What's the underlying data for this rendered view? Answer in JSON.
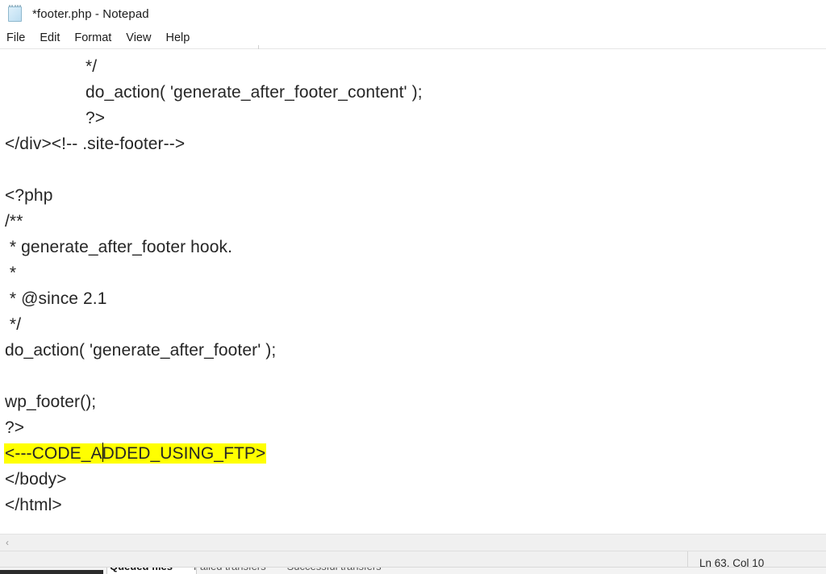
{
  "window": {
    "title": "*footer.php - Notepad",
    "icon": "notepad-icon"
  },
  "menu": {
    "items": [
      {
        "label": "File"
      },
      {
        "label": "Edit"
      },
      {
        "label": "Format"
      },
      {
        "label": "View"
      },
      {
        "label": "Help"
      }
    ]
  },
  "editor": {
    "lines": [
      {
        "text": "*/",
        "indent": true,
        "blank": false,
        "highlight": false
      },
      {
        "text": "do_action( 'generate_after_footer_content' );",
        "indent": true,
        "blank": false,
        "highlight": false
      },
      {
        "text": "?>",
        "indent": true,
        "blank": false,
        "highlight": false
      },
      {
        "text": "</div><!-- .site-footer-->",
        "indent": false,
        "blank": false,
        "highlight": false
      },
      {
        "text": "",
        "indent": false,
        "blank": true,
        "highlight": false
      },
      {
        "text": "<?php",
        "indent": false,
        "blank": false,
        "highlight": false
      },
      {
        "text": "/**",
        "indent": false,
        "blank": false,
        "highlight": false
      },
      {
        "text": " * generate_after_footer hook.",
        "indent": false,
        "blank": false,
        "highlight": false
      },
      {
        "text": " *",
        "indent": false,
        "blank": false,
        "highlight": false
      },
      {
        "text": " * @since 2.1",
        "indent": false,
        "blank": false,
        "highlight": false
      },
      {
        "text": " */",
        "indent": false,
        "blank": false,
        "highlight": false
      },
      {
        "text": "do_action( 'generate_after_footer' );",
        "indent": false,
        "blank": false,
        "highlight": false
      },
      {
        "text": "",
        "indent": false,
        "blank": true,
        "highlight": false
      },
      {
        "text": "wp_footer();",
        "indent": false,
        "blank": false,
        "highlight": false
      },
      {
        "text": "?>",
        "indent": false,
        "blank": false,
        "highlight": false
      },
      {
        "text": "<---CODE_ADDED_USING_FTP>",
        "indent": false,
        "blank": false,
        "highlight": true,
        "caret_after": 10
      },
      {
        "text": "</body>",
        "indent": false,
        "blank": false,
        "highlight": false
      },
      {
        "text": "</html>",
        "indent": false,
        "blank": false,
        "highlight": false
      }
    ],
    "highlight_color": "#ffff00",
    "text_color": "#262626"
  },
  "scrollbar": {
    "left_arrow": "‹"
  },
  "status_bar": {
    "position": "Ln 63, Col 10"
  },
  "background_app": {
    "tabs": [
      {
        "label": "Queued files",
        "active": true
      },
      {
        "label": "Failed transfers",
        "active": false
      },
      {
        "label": "Successful transfers",
        "active": false
      }
    ]
  }
}
